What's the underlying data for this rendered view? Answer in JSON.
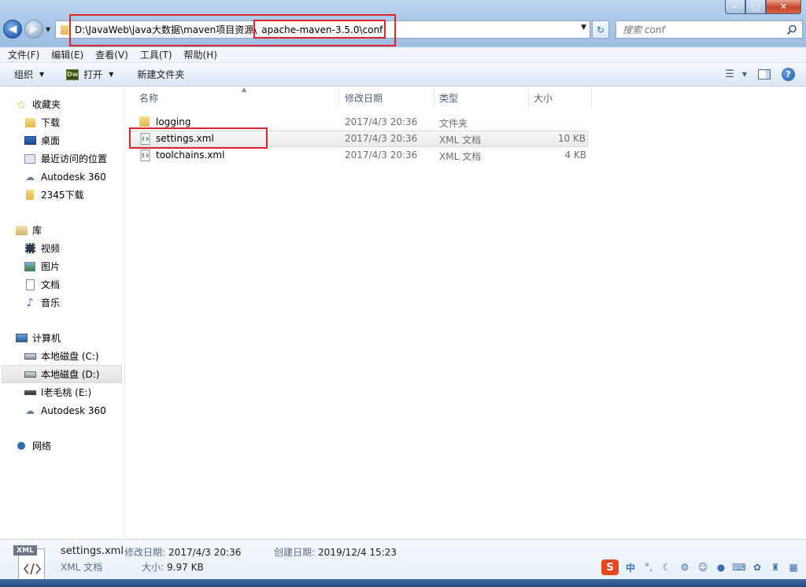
{
  "window": {
    "minimize": "–",
    "maximize": "□",
    "close": "✕"
  },
  "address": {
    "path_part1": "D:\\JavaWeb\\java大数据\\maven项目资源\\",
    "path_part2": "apache-maven-3.5.0\\conf"
  },
  "search": {
    "placeholder": "搜索 conf"
  },
  "menu": [
    "文件(F)",
    "编辑(E)",
    "查看(V)",
    "工具(T)",
    "帮助(H)"
  ],
  "toolbar": {
    "organize": "组织",
    "open_icon_text": "Dw",
    "open": "打开",
    "new_folder": "新建文件夹"
  },
  "sidebar": {
    "favorites": {
      "title": "收藏夹",
      "items": [
        "下载",
        "桌面",
        "最近访问的位置",
        "Autodesk 360",
        "2345下载"
      ]
    },
    "libraries": {
      "title": "库",
      "items": [
        "视频",
        "图片",
        "文档",
        "音乐"
      ]
    },
    "computer": {
      "title": "计算机",
      "items": [
        "本地磁盘 (C:)",
        "本地磁盘 (D:)",
        "l老毛桃 (E:)",
        "Autodesk 360"
      ]
    },
    "network": {
      "title": "网络"
    }
  },
  "columns": {
    "name": "名称",
    "date": "修改日期",
    "type": "类型",
    "size": "大小"
  },
  "files": [
    {
      "name": "logging",
      "date": "2017/4/3 20:36",
      "type": "文件夹",
      "size": ""
    },
    {
      "name": "settings.xml",
      "date": "2017/4/3 20:36",
      "type": "XML 文档",
      "size": "10 KB"
    },
    {
      "name": "toolchains.xml",
      "date": "2017/4/3 20:36",
      "type": "XML 文档",
      "size": "4 KB"
    }
  ],
  "details": {
    "icon_text": "XML",
    "filename": "settings.xml",
    "filetype": "XML 文档",
    "modified_label": "修改日期:",
    "modified": "2017/4/3 20:36",
    "created_label": "创建日期:",
    "created": "2019/12/4 15:23",
    "size_label": "大小:",
    "size": "9.97 KB"
  },
  "tray": {
    "ime": "S",
    "lang": "中"
  },
  "colors": {
    "highlight_red": "#e0242e",
    "title_blue": "#a9c6e8"
  }
}
